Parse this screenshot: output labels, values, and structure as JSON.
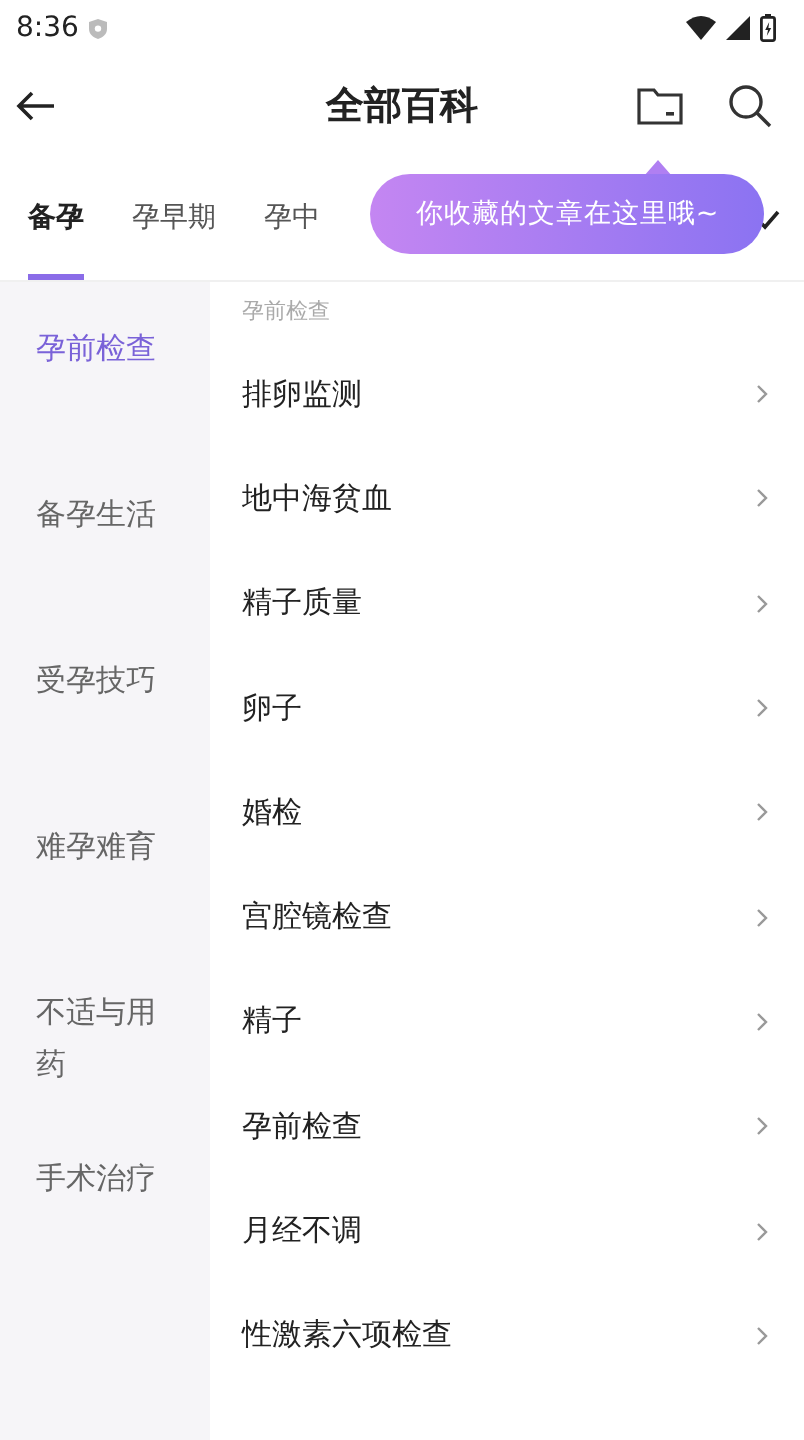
{
  "status_bar": {
    "time": "8:36"
  },
  "header": {
    "title": "全部百科"
  },
  "tabs": [
    {
      "label": "备孕",
      "selected": true
    },
    {
      "label": "孕早期",
      "selected": false
    },
    {
      "label": "孕中",
      "selected": false
    }
  ],
  "tooltip": {
    "text": "你收藏的文章在这里哦~"
  },
  "sidebar": {
    "items": [
      {
        "label": "孕前检查",
        "selected": true
      },
      {
        "label": "备孕生活",
        "selected": false
      },
      {
        "label": "受孕技巧",
        "selected": false
      },
      {
        "label": "难孕难育",
        "selected": false
      },
      {
        "label": "不适与用药",
        "selected": false
      },
      {
        "label": "手术治疗",
        "selected": false
      }
    ]
  },
  "section": {
    "title": "孕前检查",
    "items": [
      "排卵监测",
      "地中海贫血",
      "精子质量",
      "卵子",
      "婚检",
      "宫腔镜检查",
      "精子",
      "孕前检查",
      "月经不调",
      "性激素六项检查"
    ]
  }
}
